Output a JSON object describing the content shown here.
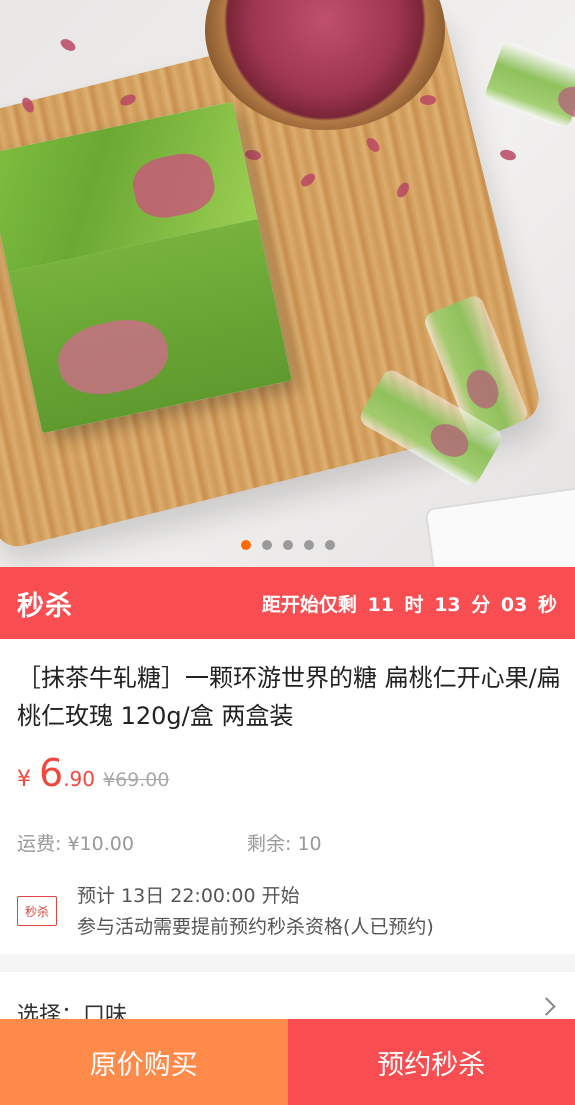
{
  "hero": {
    "image_label": "product-photo-matcha-nougat",
    "carousel": {
      "total": 5,
      "active_index": 0,
      "active_color": "#ff6a00"
    }
  },
  "flash_sale": {
    "title": "秒杀",
    "countdown_prefix": "距开始仅剩",
    "hours": "11",
    "hours_unit": "时",
    "minutes": "13",
    "minutes_unit": "分",
    "seconds": "03",
    "seconds_unit": "秒",
    "bg_color": "#f84e51"
  },
  "product": {
    "title": "［抹茶牛轧糖］一颗环游世界的糖 扁桃仁开心果/扁桃仁玫瑰 120g/盒 两盒装",
    "currency": "¥",
    "price_integer": "6",
    "price_decimal": ".90",
    "original_price": "¥69.00",
    "shipping": "运费: ¥10.00",
    "stock": "剩余: 10",
    "badge": "秒杀",
    "schedule": "预计 13日 22:00:00 开始",
    "reservation_note": "参与活动需要提前预约秒杀资格(人已预约)"
  },
  "options": {
    "label": "选择：口味"
  },
  "actions": {
    "buy_original": "原价购买",
    "reserve_flash": "预约秒杀"
  }
}
